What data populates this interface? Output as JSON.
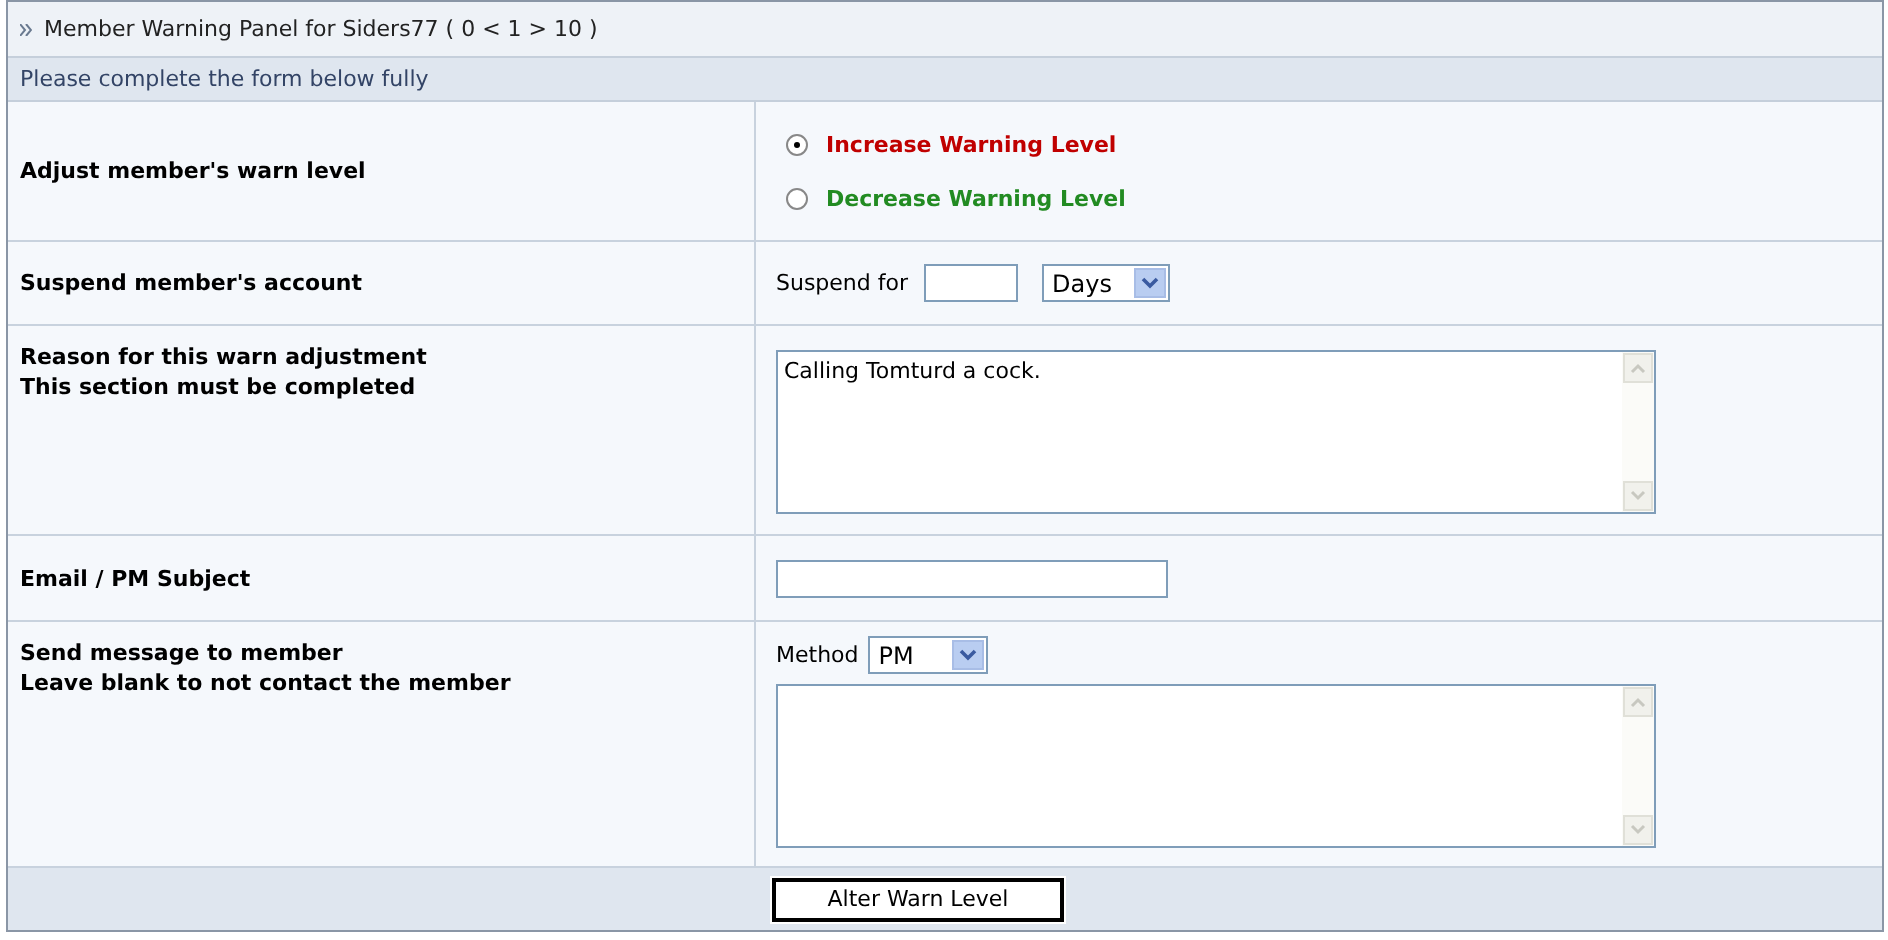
{
  "panel": {
    "title": "Member Warning Panel for Siders77 ( 0 < 1 > 10 )",
    "subtitle": "Please complete the form below fully"
  },
  "rows": [
    {
      "kind": "radios",
      "labels": [
        "Adjust member's warn level"
      ],
      "options": [
        {
          "label": "Increase Warning Level",
          "selected": true,
          "color": "#c00000"
        },
        {
          "label": "Decrease Warning Level",
          "selected": false,
          "color": "#228b22"
        }
      ]
    },
    {
      "kind": "suspend",
      "labels": [
        "Suspend member's account"
      ],
      "prefix": "Suspend for",
      "value": "",
      "unit": "Days"
    },
    {
      "kind": "textarea",
      "labels": [
        "Reason for this warn adjustment",
        "This section must be completed"
      ],
      "value": "Calling Tomturd a cock."
    },
    {
      "kind": "text",
      "labels": [
        "Email / PM Subject"
      ],
      "value": ""
    },
    {
      "kind": "message",
      "labels": [
        "Send message to member",
        "Leave blank to not contact the member"
      ],
      "method_label": "Method",
      "method": "PM",
      "value": ""
    }
  ],
  "submit": "Alter Warn Level"
}
